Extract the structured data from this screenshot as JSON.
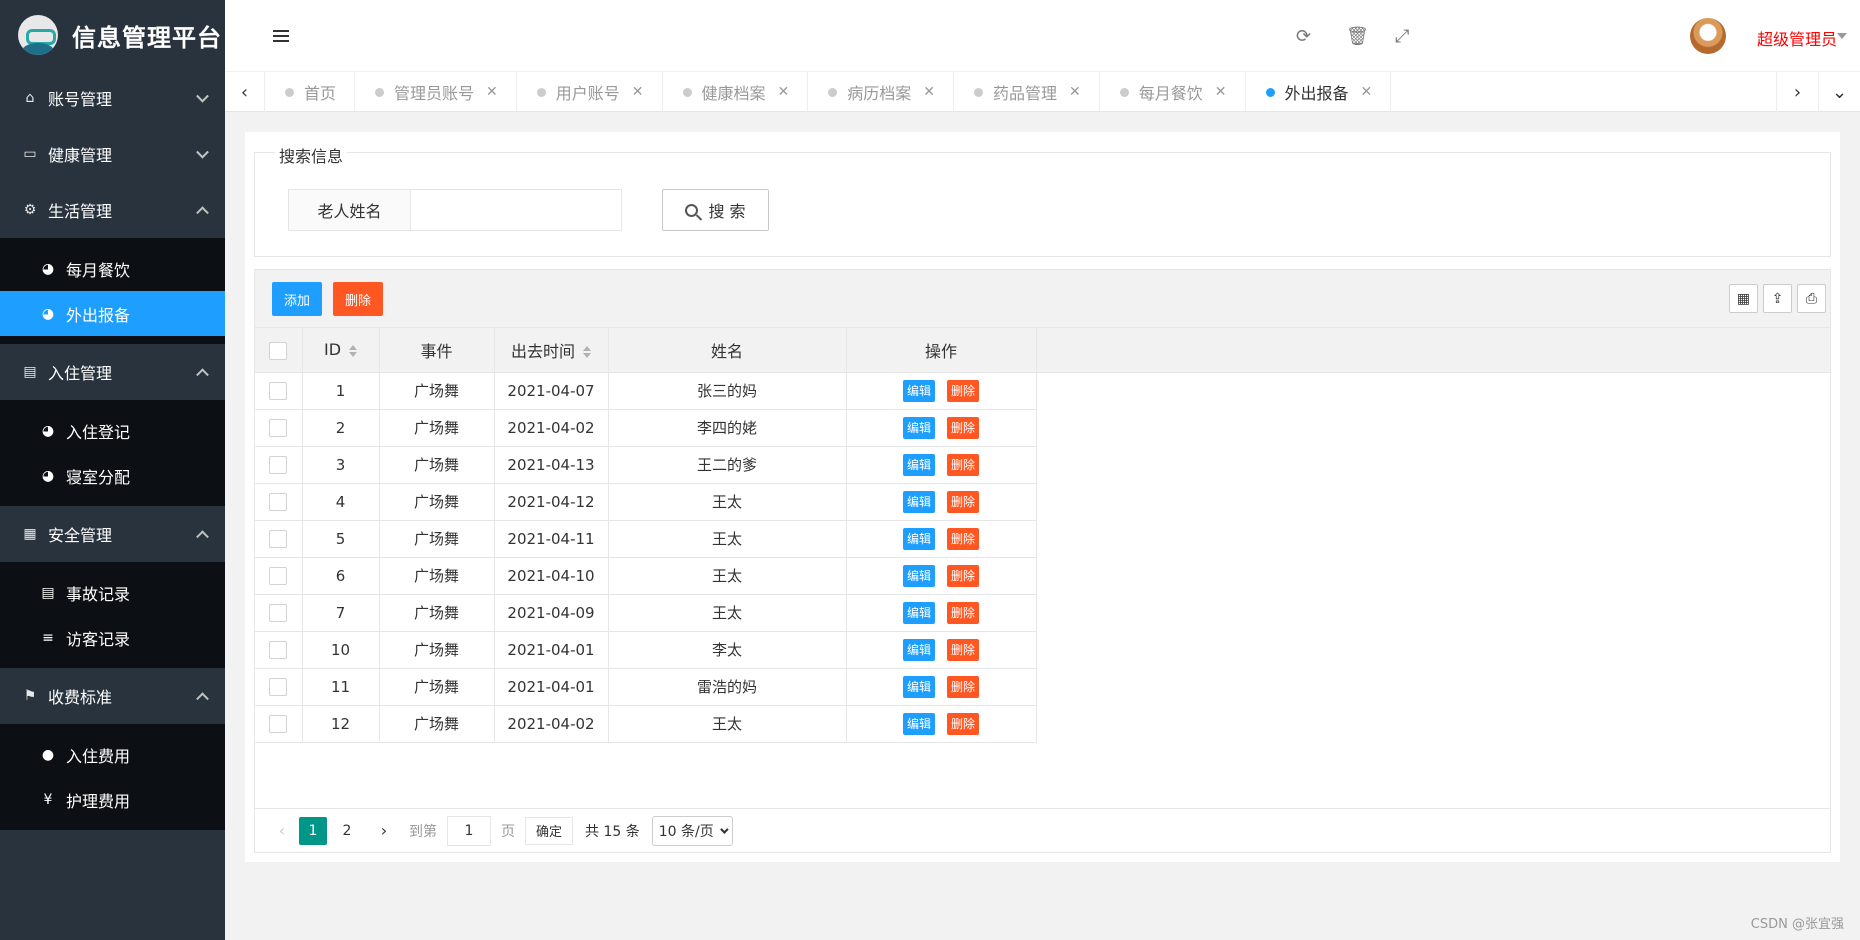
{
  "app": {
    "title": "信息管理平台"
  },
  "sidebar": {
    "groups": [
      {
        "label": "账号管理",
        "icon": "home-icon",
        "expanded": false,
        "items": []
      },
      {
        "label": "健康管理",
        "icon": "window-icon",
        "expanded": false,
        "items": []
      },
      {
        "label": "生活管理",
        "icon": "gears-icon",
        "expanded": true,
        "items": [
          {
            "label": "每月餐饮",
            "icon": "dashboard-icon",
            "active": false
          },
          {
            "label": "外出报备",
            "icon": "dashboard-icon",
            "active": true
          }
        ]
      },
      {
        "label": "入住管理",
        "icon": "file-icon",
        "expanded": true,
        "items": [
          {
            "label": "入住登记",
            "icon": "dashboard-icon",
            "active": false
          },
          {
            "label": "寝室分配",
            "icon": "dashboard-icon",
            "active": false
          }
        ]
      },
      {
        "label": "安全管理",
        "icon": "calendar-icon",
        "expanded": true,
        "items": [
          {
            "label": "事故记录",
            "icon": "list-alt-icon",
            "active": false
          },
          {
            "label": "访客记录",
            "icon": "bars-icon",
            "active": false
          }
        ]
      },
      {
        "label": "收费标准",
        "icon": "flag-icon",
        "expanded": true,
        "items": [
          {
            "label": "入住费用",
            "icon": "circle-icon",
            "active": false
          },
          {
            "label": "护理费用",
            "icon": "yen-icon",
            "active": false
          }
        ]
      }
    ]
  },
  "header": {
    "user_name": "超级管理员"
  },
  "tabs": [
    {
      "label": "首页",
      "closable": false,
      "active": false
    },
    {
      "label": "管理员账号",
      "closable": true,
      "active": false
    },
    {
      "label": "用户账号",
      "closable": true,
      "active": false
    },
    {
      "label": "健康档案",
      "closable": true,
      "active": false
    },
    {
      "label": "病历档案",
      "closable": true,
      "active": false
    },
    {
      "label": "药品管理",
      "closable": true,
      "active": false
    },
    {
      "label": "每月餐饮",
      "closable": true,
      "active": false
    },
    {
      "label": "外出报备",
      "closable": true,
      "active": true
    }
  ],
  "search": {
    "legend": "搜索信息",
    "label": "老人姓名",
    "value": "",
    "button": "搜 索"
  },
  "toolbar": {
    "add_label": "添加",
    "delete_label": "删除"
  },
  "table": {
    "columns": [
      "ID",
      "事件",
      "出去时间",
      "姓名",
      "操作"
    ],
    "edit_label": "编辑",
    "delete_label": "删除",
    "rows": [
      {
        "id": "1",
        "event": "广场舞",
        "time": "2021-04-07",
        "name": "张三的妈"
      },
      {
        "id": "2",
        "event": "广场舞",
        "time": "2021-04-02",
        "name": "李四的姥"
      },
      {
        "id": "3",
        "event": "广场舞",
        "time": "2021-04-13",
        "name": "王二的爹"
      },
      {
        "id": "4",
        "event": "广场舞",
        "time": "2021-04-12",
        "name": "王太"
      },
      {
        "id": "5",
        "event": "广场舞",
        "time": "2021-04-11",
        "name": "王太"
      },
      {
        "id": "6",
        "event": "广场舞",
        "time": "2021-04-10",
        "name": "王太"
      },
      {
        "id": "7",
        "event": "广场舞",
        "time": "2021-04-09",
        "name": "王太"
      },
      {
        "id": "10",
        "event": "广场舞",
        "time": "2021-04-01",
        "name": "李太"
      },
      {
        "id": "11",
        "event": "广场舞",
        "time": "2021-04-01",
        "name": "雷浩的妈"
      },
      {
        "id": "12",
        "event": "广场舞",
        "time": "2021-04-02",
        "name": "王太"
      }
    ]
  },
  "pager": {
    "pages": [
      "1",
      "2"
    ],
    "current": "1",
    "goto_prefix": "到第",
    "goto_value": "1",
    "goto_suffix": "页",
    "confirm": "确定",
    "total": "共 15 条",
    "page_size": "10 条/页"
  },
  "watermark": "CSDN @张宜强",
  "colors": {
    "primary": "#1e9fff",
    "danger": "#ff5722",
    "pager_active": "#009688",
    "sidebar_bg": "#28333e",
    "submenu_bg": "#0c0f13",
    "user_name": "#ff0000"
  }
}
